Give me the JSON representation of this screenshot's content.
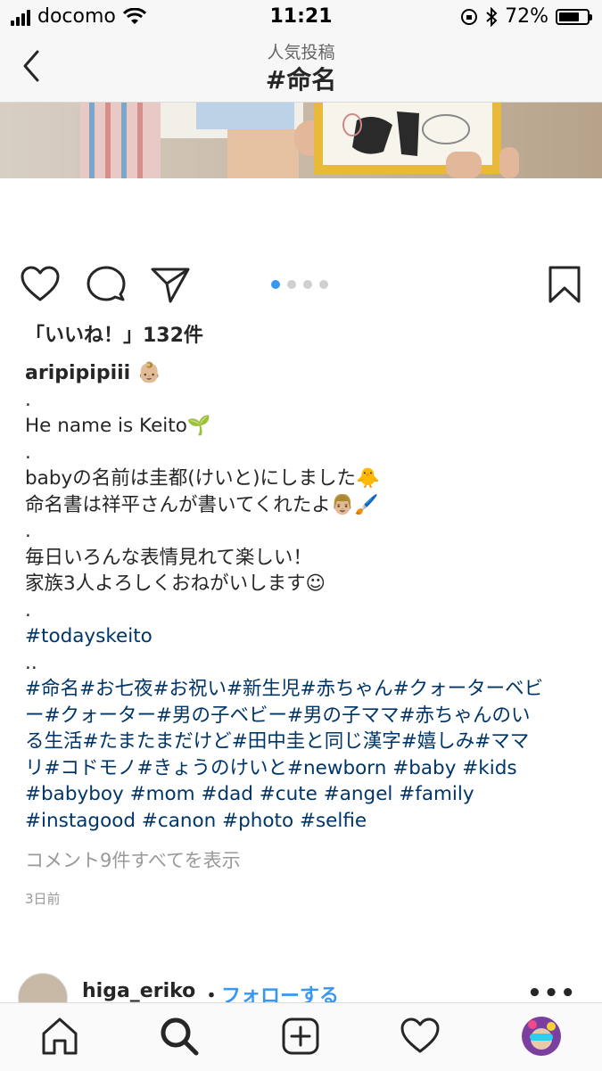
{
  "status_bar": {
    "carrier": "docomo",
    "time": "11:21",
    "battery_text": "72%",
    "battery_level": 0.72
  },
  "nav": {
    "subtitle": "人気投稿",
    "title": "#命名",
    "back_icon": "chevron-left-icon"
  },
  "post": {
    "likes": "「いいね！」132件",
    "carousel": {
      "count": 4,
      "active": 1
    },
    "caption_lines": [
      {
        "text": "aripipipiii 👶🏼",
        "kind": "user"
      },
      {
        "text": ".",
        "kind": "text"
      },
      {
        "text": "He name is Keito🌱",
        "kind": "text"
      },
      {
        "text": ".",
        "kind": "text"
      },
      {
        "text": "babyの名前は圭都(けいと)にしました🐥",
        "kind": "text"
      },
      {
        "text": "命名書は祥平さんが書いてくれたよ👨🏼🖌️",
        "kind": "text"
      },
      {
        "text": ".",
        "kind": "text"
      },
      {
        "text": "毎日いろんな表情見れて楽しい！",
        "kind": "text"
      },
      {
        "text": "家族3人よろしくおねがいします☺︎",
        "kind": "text"
      },
      {
        "text": ".",
        "kind": "text"
      },
      {
        "text": "#todayskeito",
        "kind": "tag"
      },
      {
        "text": "..",
        "kind": "text"
      },
      {
        "text": "#命名#お七夜#お祝い#新生児#赤ちゃん#クォーターベビ",
        "kind": "tag"
      },
      {
        "text": "ー#クォーター#男の子ベビー#男の子ママ#赤ちゃんのい",
        "kind": "tag"
      },
      {
        "text": "る生活#たまたまだけど#田中圭と同じ漢字#嬉しみ#ママ",
        "kind": "tag"
      },
      {
        "text": "リ#コドモノ#きょうのけいと#newborn #baby #kids",
        "kind": "tag"
      },
      {
        "text": "#babyboy #mom #dad #cute #angel #family",
        "kind": "tag"
      },
      {
        "text": "#instagood #canon #photo #selfie",
        "kind": "tag"
      }
    ],
    "view_comments": "コメント9件すべてを表示",
    "time_ago": "3日前"
  },
  "next_post": {
    "username": "higa_eriko",
    "separator": "・",
    "follow_label": "フォローする",
    "more_label": "•••"
  },
  "colors": {
    "hashtag": "#003569",
    "link_blue": "#3897f0",
    "muted": "#999999"
  }
}
